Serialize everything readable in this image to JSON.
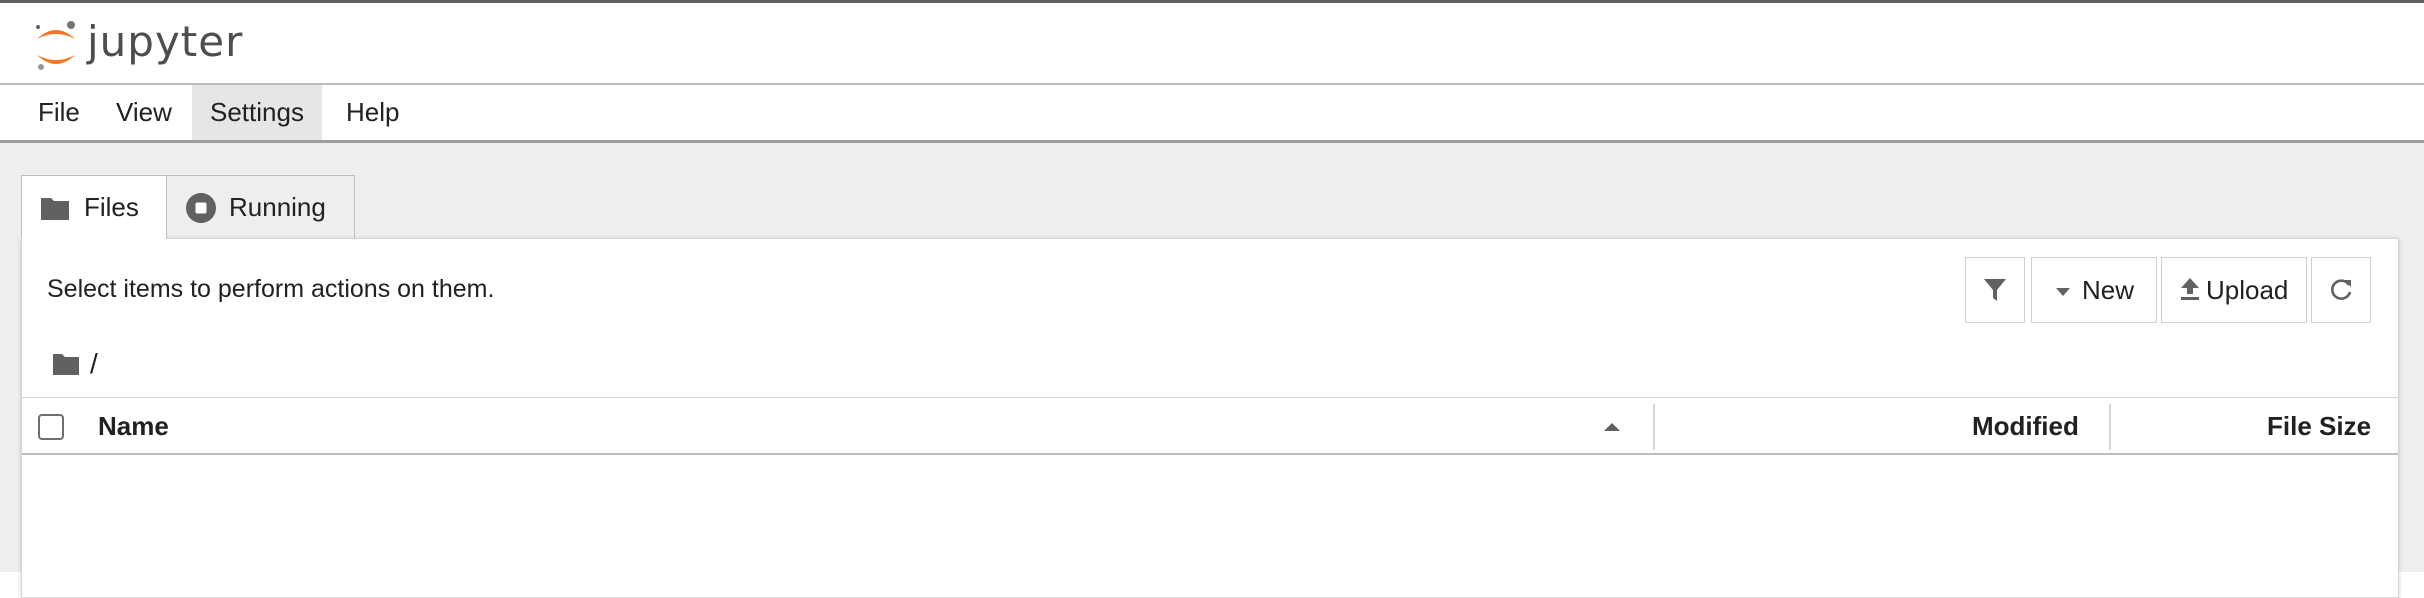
{
  "app": {
    "logo_text": "jupyter"
  },
  "menu": {
    "items": [
      {
        "label": "File"
      },
      {
        "label": "View"
      },
      {
        "label": "Settings"
      },
      {
        "label": "Help"
      }
    ]
  },
  "tabs": [
    {
      "label": "Files",
      "icon": "folder-icon",
      "active": true
    },
    {
      "label": "Running",
      "icon": "stop-circle-icon",
      "active": false
    }
  ],
  "filebrowser": {
    "hint": "Select items to perform actions on them.",
    "toolbar": {
      "filter_icon": "filter-icon",
      "new_label": "New",
      "upload_label": "Upload",
      "refresh_icon": "refresh-icon"
    },
    "breadcrumb": {
      "root_icon": "folder-icon",
      "separator": "/"
    },
    "columns": {
      "name": "Name",
      "modified": "Modified",
      "file_size": "File Size"
    },
    "sort_direction_icon": "caret-up-icon",
    "rows": []
  },
  "colors": {
    "logo_orange": "#F37726",
    "icon_gray": "#616161",
    "menu_active_bg": "#E6E6E6",
    "background": "#EEEEEE"
  }
}
